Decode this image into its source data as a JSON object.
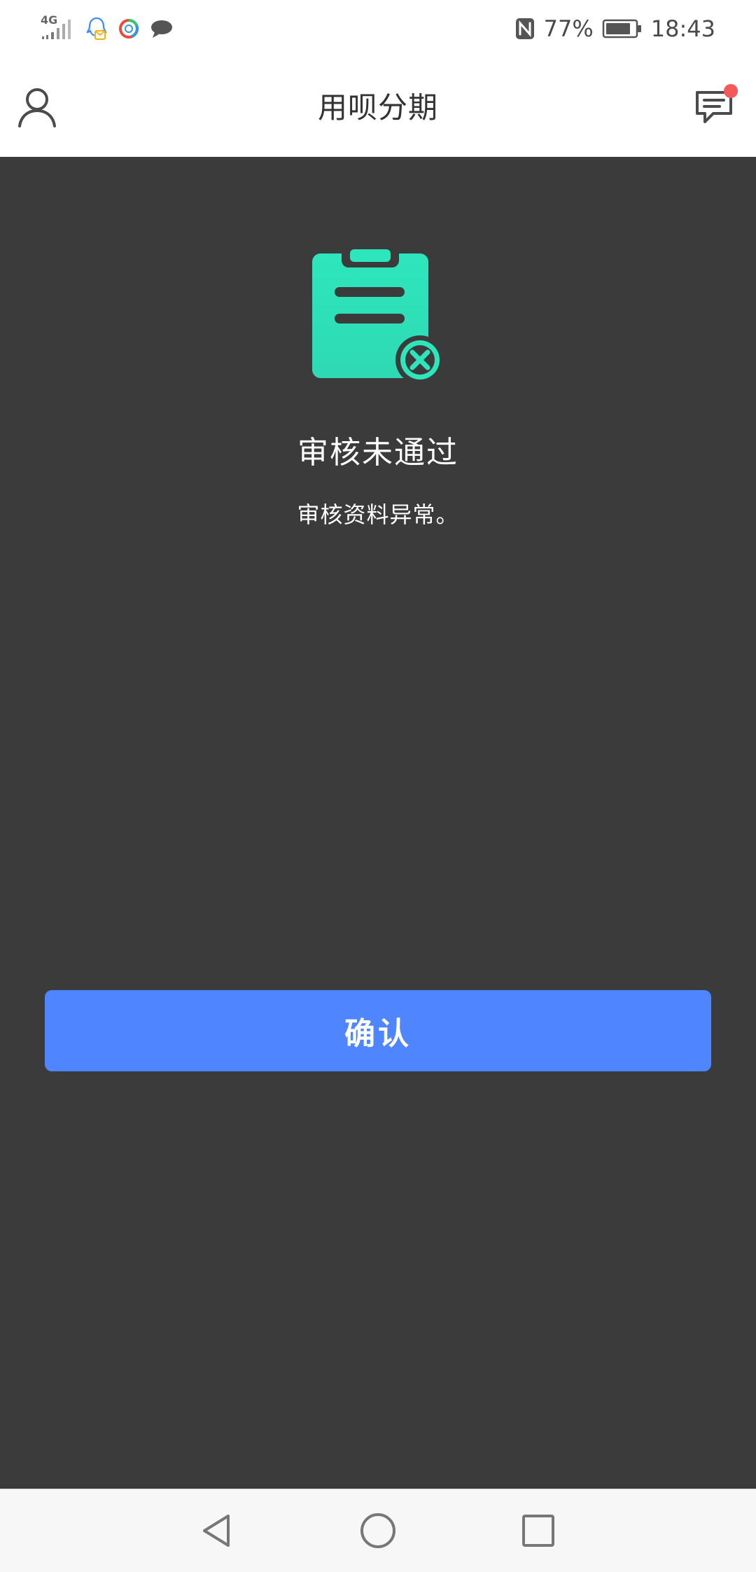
{
  "status_bar": {
    "network": "4G",
    "battery_percent": "77%",
    "time": "18:43"
  },
  "header": {
    "title": "用呗分期",
    "profile_icon": "user-icon",
    "message_icon": "message-icon"
  },
  "result": {
    "title": "审核未通过",
    "description": "审核资料异常。",
    "icon": "clipboard-reject-icon",
    "accent_color": "#2fe0b4"
  },
  "actions": {
    "confirm_label": "确认"
  },
  "navigation": {
    "back_icon": "back-triangle-icon",
    "home_icon": "home-circle-icon",
    "recent_icon": "recent-square-icon"
  },
  "colors": {
    "background": "#3b3b3c",
    "button": "#4f86ff",
    "badge": "#f45a5a"
  }
}
